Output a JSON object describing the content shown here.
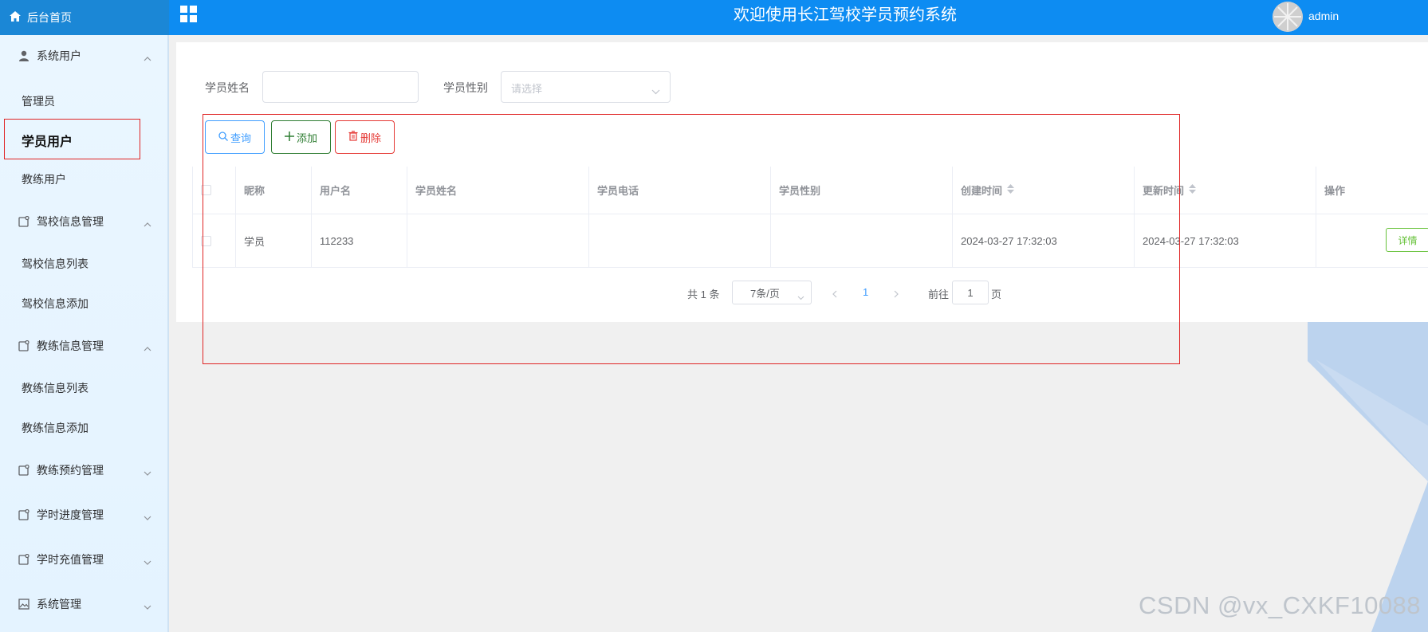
{
  "topbar": {
    "home_label": "后台首页",
    "title": "欢迎使用长江驾校学员预约系统",
    "user": "admin"
  },
  "sidebar": {
    "groups": [
      {
        "label": "系统用户",
        "icon": "user-icon",
        "expanded": true,
        "items": [
          "管理员",
          "学员用户",
          "教练用户"
        ]
      },
      {
        "label": "驾校信息管理",
        "icon": "doc-icon",
        "expanded": true,
        "items": [
          "驾校信息列表",
          "驾校信息添加"
        ]
      },
      {
        "label": "教练信息管理",
        "icon": "doc-icon",
        "expanded": true,
        "items": [
          "教练信息列表",
          "教练信息添加"
        ]
      },
      {
        "label": "教练预约管理",
        "icon": "doc-icon",
        "expanded": false
      },
      {
        "label": "学时进度管理",
        "icon": "doc-icon",
        "expanded": false
      },
      {
        "label": "学时充值管理",
        "icon": "doc-icon",
        "expanded": false
      },
      {
        "label": "系统管理",
        "icon": "image-icon",
        "expanded": false
      }
    ],
    "active_item": "学员用户"
  },
  "filters": {
    "name_label": "学员姓名",
    "name_value": "",
    "gender_label": "学员性别",
    "gender_placeholder": "请选择"
  },
  "actions": {
    "query": "查询",
    "add": "添加",
    "delete": "删除"
  },
  "table": {
    "columns": [
      "昵称",
      "用户名",
      "学员姓名",
      "学员电话",
      "学员性别",
      "创建时间",
      "更新时间",
      "操作"
    ],
    "rows": [
      {
        "nickname": "学员",
        "username": "112233",
        "name": "",
        "phone": "",
        "gender": "",
        "created": "2024-03-27 17:32:03",
        "updated": "2024-03-27 17:32:03",
        "action": "详情"
      }
    ]
  },
  "pagination": {
    "total": "共 1 条",
    "page_size": "7条/页",
    "current_page": "1",
    "goto_prefix": "前往",
    "goto_value": "1",
    "goto_suffix": "页"
  },
  "colors": {
    "header": "#0d8cf2",
    "accent": "#409eff",
    "success": "#67c23a",
    "danger": "#e53935",
    "annotation": "#e02424"
  },
  "watermark": "CSDN @vx_CXKF10088"
}
